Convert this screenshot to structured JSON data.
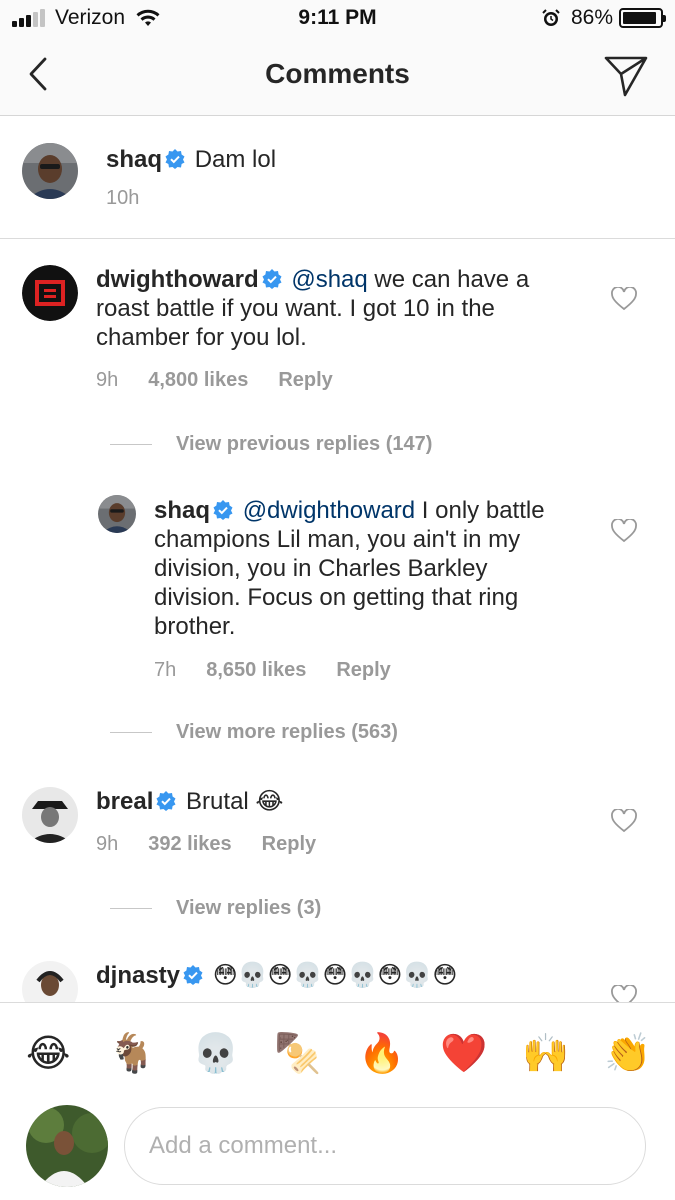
{
  "status_bar": {
    "carrier": "Verizon",
    "time": "9:11 PM",
    "battery": "86%",
    "battery_level": 0.86
  },
  "header": {
    "title": "Comments"
  },
  "caption": {
    "username": "shaq",
    "verified": true,
    "text": "Dam lol",
    "time": "10h"
  },
  "comments": [
    {
      "username": "dwighthoward",
      "verified": true,
      "mention": "@shaq",
      "text_line1_rest": " we can have a",
      "text_line2": "roast battle if you want. I got 10 in the",
      "text_line3": "chamber for you lol.",
      "time": "9h",
      "likes": "4,800 likes",
      "reply_label": "Reply",
      "view_previous": "View previous replies (147)",
      "reply": {
        "username": "shaq",
        "verified": true,
        "mention": "@dwighthoward",
        "text_line1_rest": " I only battle",
        "text_line2": "champions Lil man, you ain't in my",
        "text_line3": "division, you in Charles Barkley",
        "text_line4": "division. Focus on getting that ring",
        "text_line5": "brother.",
        "time": "7h",
        "likes": "8,650 likes",
        "reply_label": "Reply"
      },
      "view_more": "View more replies (563)"
    },
    {
      "username": "breal",
      "verified": true,
      "text": "Brutal 😂",
      "time": "9h",
      "likes": "392 likes",
      "reply_label": "Reply",
      "view_replies": "View replies (3)"
    },
    {
      "username": "djnasty",
      "verified": true,
      "text": "😳💀😳💀😳💀😳💀😳"
    }
  ],
  "emoji_bar": {
    "emojis": [
      "😂",
      "🐐",
      "💀",
      "🍢",
      "🔥",
      "❤️",
      "🙌",
      "👏"
    ]
  },
  "input": {
    "placeholder": "Add a comment..."
  },
  "colors": {
    "mention": "#003569",
    "verified": "#3897f0",
    "meta": "#999999",
    "heart_red": "#ed4956"
  },
  "icons": {
    "back": "chevron-left-icon",
    "send": "direct-send-icon",
    "heart": "heart-outline-icon",
    "verified": "verified-badge-icon"
  }
}
